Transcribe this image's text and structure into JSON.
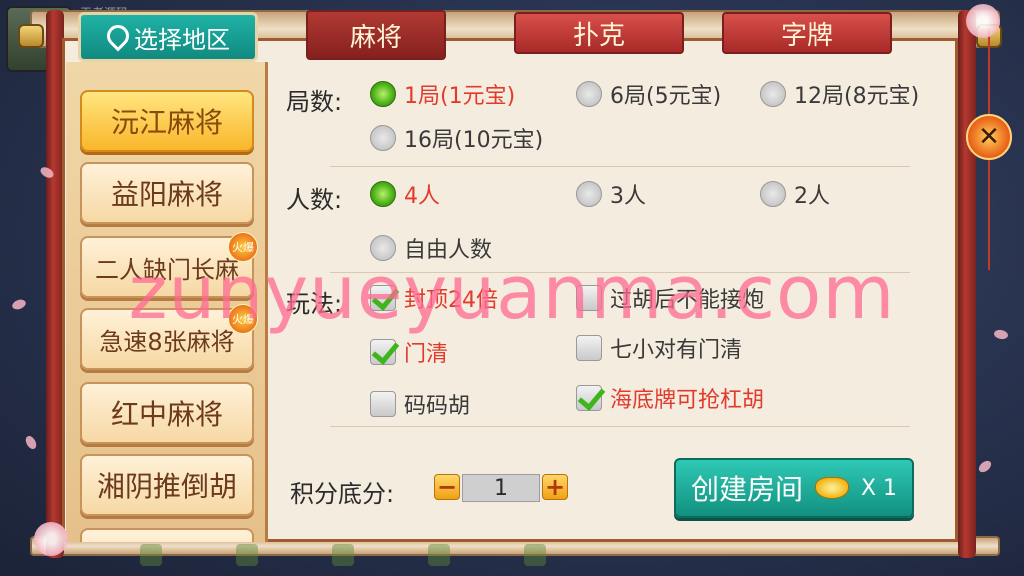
{
  "header": {
    "region_button_label": "选择地区",
    "top_left_text": "王者源码"
  },
  "tabs": [
    {
      "label": "麻将",
      "active": true
    },
    {
      "label": "扑克",
      "active": false
    },
    {
      "label": "字牌",
      "active": false
    }
  ],
  "sidebar": {
    "items": [
      {
        "label": "沅江麻将",
        "active": true,
        "hot": false
      },
      {
        "label": "益阳麻将",
        "active": false,
        "hot": false
      },
      {
        "label": "二人缺门长麻",
        "active": false,
        "hot": true
      },
      {
        "label": "急速8张麻将",
        "active": false,
        "hot": true
      },
      {
        "label": "红中麻将",
        "active": false,
        "hot": false
      },
      {
        "label": "湘阴推倒胡",
        "active": false,
        "hot": false
      }
    ],
    "hot_badge_label": "火爆"
  },
  "rounds": {
    "label": "局数:",
    "options": [
      {
        "label": "1局(1元宝)",
        "selected": true
      },
      {
        "label": "6局(5元宝)",
        "selected": false
      },
      {
        "label": "12局(8元宝)",
        "selected": false
      },
      {
        "label": "16局(10元宝)",
        "selected": false
      }
    ]
  },
  "players": {
    "label": "人数:",
    "options": [
      {
        "label": "4人",
        "selected": true
      },
      {
        "label": "3人",
        "selected": false
      },
      {
        "label": "2人",
        "selected": false
      },
      {
        "label": "自由人数",
        "selected": false
      }
    ]
  },
  "rules": {
    "label": "玩法:",
    "options": [
      {
        "label": "封顶24倍",
        "checked": true
      },
      {
        "label": "过胡后不能接炮",
        "checked": false
      },
      {
        "label": "门清",
        "checked": true
      },
      {
        "label": "七小对有门清",
        "checked": false
      },
      {
        "label": "码码胡",
        "checked": false
      },
      {
        "label": "海底牌可抢杠胡",
        "checked": true
      }
    ]
  },
  "score": {
    "label": "积分底分:",
    "value": "1",
    "minus_label": "−",
    "plus_label": "+"
  },
  "create_button": {
    "label": "创建房间",
    "cost": "X 1"
  },
  "close_button_label": "✕",
  "watermark": "zunyueyuanma.com",
  "colors": {
    "selected_text": "#e23b2e",
    "primary_teal": "#1fb2a6",
    "tab_red": "#a82a28"
  }
}
